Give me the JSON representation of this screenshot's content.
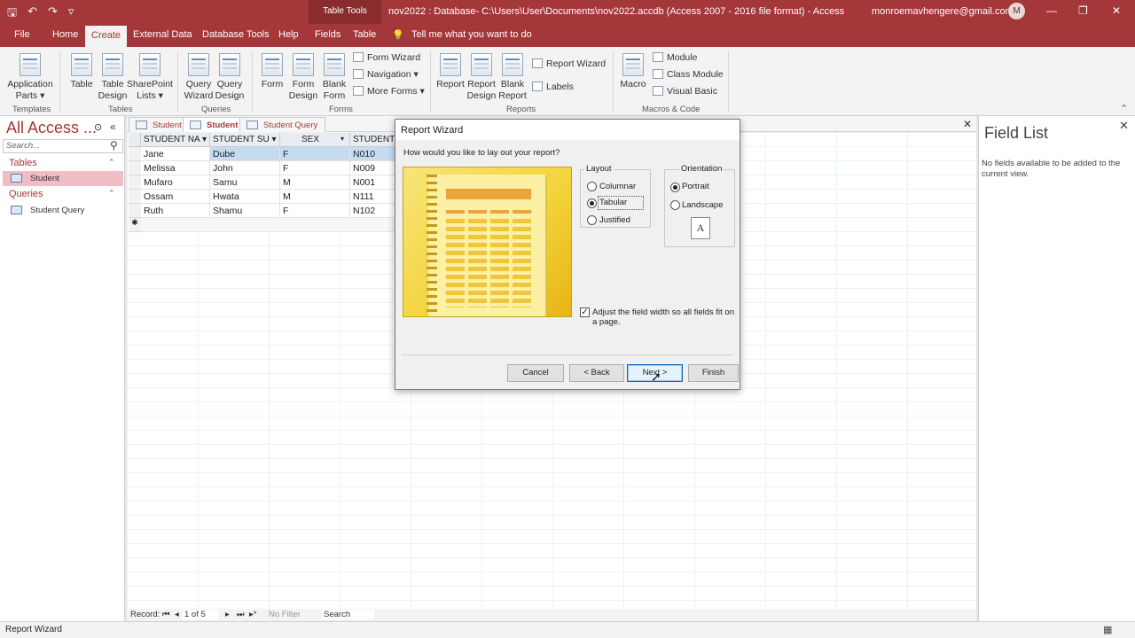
{
  "titlebar": {
    "context_tab": "Table Tools",
    "window_title": "nov2022 : Database- C:\\Users\\User\\Documents\\nov2022.accdb (Access 2007 - 2016 file format)  -  Access",
    "account": "monroemavhengere@gmail.com",
    "avatar_initial": "M"
  },
  "ribbon_tabs": [
    "File",
    "Home",
    "Create",
    "External Data",
    "Database Tools",
    "Help",
    "Fields",
    "Table"
  ],
  "tell_me": "Tell me what you want to do",
  "ribbon": {
    "templates": {
      "app_parts": "Application",
      "app_parts2": "Parts ▾",
      "group": "Templates"
    },
    "tables": {
      "table": "Table",
      "table_design": "Table",
      "table_design2": "Design",
      "sharepoint": "SharePoint",
      "sharepoint2": "Lists ▾",
      "group": "Tables"
    },
    "queries": {
      "wizard": "Query",
      "wizard2": "Wizard",
      "design": "Query",
      "design2": "Design",
      "group": "Queries"
    },
    "forms": {
      "form": "Form",
      "form_design": "Form",
      "form_design2": "Design",
      "blank": "Blank",
      "blank2": "Form",
      "form_wizard": "Form Wizard",
      "navigation": "Navigation ▾",
      "more_forms": "More Forms ▾",
      "group": "Forms"
    },
    "reports": {
      "report": "Report",
      "report_design": "Report",
      "report_design2": "Design",
      "blank": "Blank",
      "blank2": "Report",
      "report_wizard": "Report Wizard",
      "labels": "Labels",
      "group": "Reports"
    },
    "macros": {
      "macro": "Macro",
      "module": "Module",
      "class_module": "Class Module",
      "visual_basic": "Visual Basic",
      "group": "Macros & Code"
    }
  },
  "nav": {
    "title": "All Access ...",
    "search_placeholder": "Search...",
    "tables_header": "Tables",
    "tables": [
      "Student"
    ],
    "queries_header": "Queries",
    "queries": [
      "Student Query"
    ]
  },
  "doc_tabs": [
    "Student",
    "Student",
    "Student Query"
  ],
  "datasheet": {
    "columns": [
      "STUDENT NA ▾",
      "STUDENT SU ▾",
      "SEX",
      "STUDENT"
    ],
    "rows": [
      [
        "Jane",
        "Dube",
        "F",
        "N010"
      ],
      [
        "Melissa",
        "John",
        "F",
        "N009"
      ],
      [
        "Mufaro",
        "Samu",
        "M",
        "N001"
      ],
      [
        "Ossam",
        "Hwata",
        "M",
        "N111"
      ],
      [
        "Ruth",
        "Shamu",
        "F",
        "N102"
      ]
    ]
  },
  "record_nav": {
    "label": "Record:",
    "position": "1 of 5",
    "filter": "No Filter",
    "search": "Search"
  },
  "field_list": {
    "title": "Field List",
    "message": "No fields available to be added to the current view."
  },
  "status": "Report Wizard",
  "dialog": {
    "title": "Report Wizard",
    "question": "How would you like to lay out your report?",
    "layout_label": "Layout",
    "layout_options": [
      "Columnar",
      "Tabular",
      "Justified"
    ],
    "layout_selected": "Tabular",
    "orientation_label": "Orientation",
    "orientation_options": [
      "Portrait",
      "Landscape"
    ],
    "orientation_selected": "Portrait",
    "orientation_icon": "A",
    "adjust_label": "Adjust the field width so all fields fit on a page.",
    "adjust_checked": true,
    "buttons": {
      "cancel": "Cancel",
      "back": "< Back",
      "next": "Next >",
      "finish": "Finish"
    }
  },
  "colors": {
    "accent": "#a4373a",
    "selected_row": "#c5dcf0",
    "nav_selected": "#f0bcc5"
  }
}
